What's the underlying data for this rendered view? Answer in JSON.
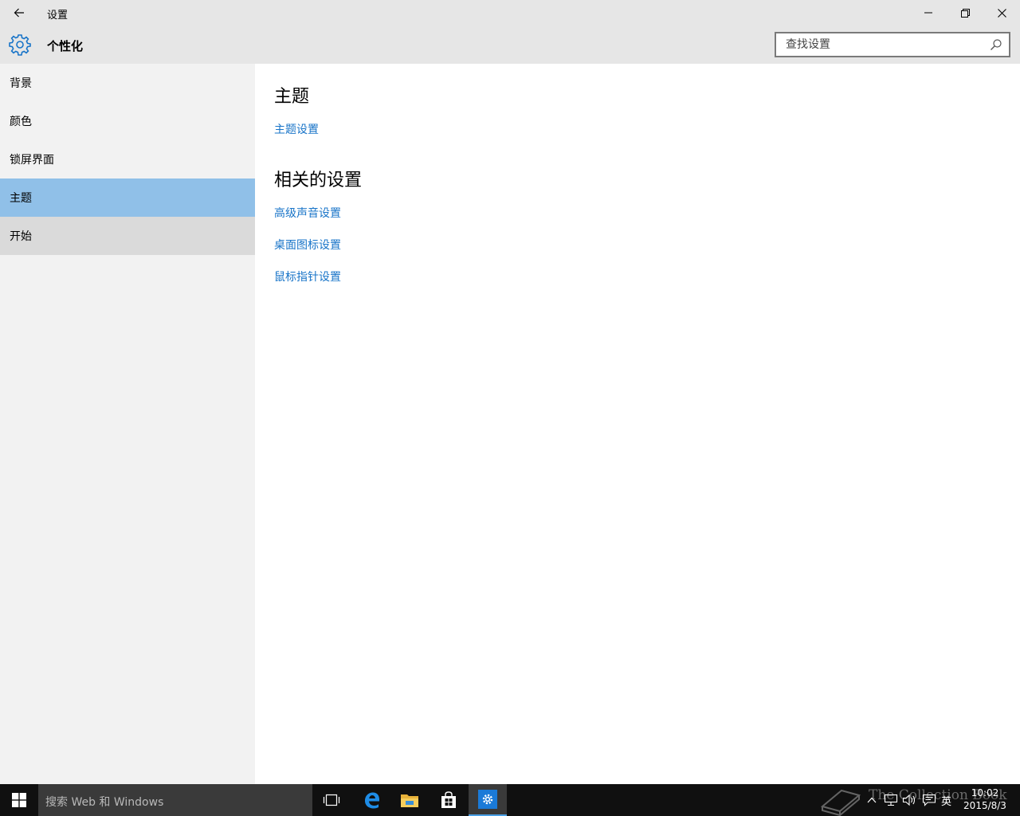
{
  "window": {
    "title": "设置"
  },
  "header": {
    "title": "个性化",
    "search_placeholder": "查找设置"
  },
  "sidebar": {
    "items": [
      {
        "label": "背景"
      },
      {
        "label": "颜色"
      },
      {
        "label": "锁屏界面"
      },
      {
        "label": "主题"
      },
      {
        "label": "开始"
      }
    ],
    "selected": "主题"
  },
  "content": {
    "section1": {
      "heading": "主题",
      "links": [
        "主题设置"
      ]
    },
    "section2": {
      "heading": "相关的设置",
      "links": [
        "高级声音设置",
        "桌面图标设置",
        "鼠标指针设置"
      ]
    }
  },
  "taskbar": {
    "search_placeholder": "搜索 Web 和 Windows",
    "language": "英",
    "time": "10:02",
    "date": "2015/8/3",
    "watermark": "The Collection Book"
  },
  "colors": {
    "accent": "#1874c8",
    "selected_item": "#90c0e8",
    "hover_item": "#dadada",
    "titlebar": "#e6e6e6",
    "sidebar": "#f2f2f2",
    "taskbar": "#101010"
  }
}
